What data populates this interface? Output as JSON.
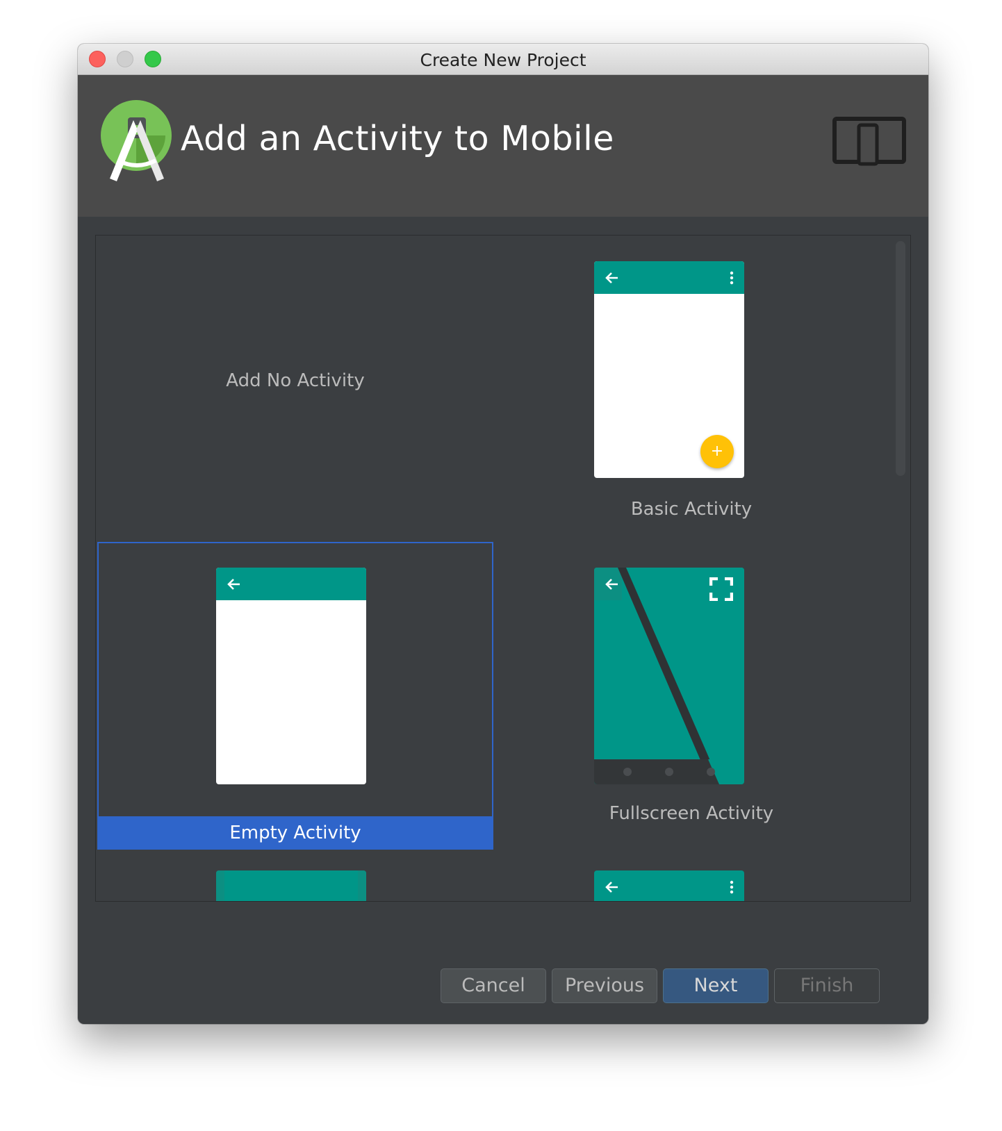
{
  "window": {
    "title": "Create New Project"
  },
  "header": {
    "heading": "Add an Activity to Mobile",
    "logo_icon": "android-studio-logo-icon",
    "device_icon": "phone-tablet-icon"
  },
  "gallery": {
    "tiles": [
      {
        "label": "Add No Activity",
        "selected": false
      },
      {
        "label": "Basic Activity",
        "selected": false
      },
      {
        "label": "Empty Activity",
        "selected": true
      },
      {
        "label": "Fullscreen Activity",
        "selected": false
      }
    ],
    "fab_glyph": "+"
  },
  "buttons": {
    "cancel": "Cancel",
    "previous": "Previous",
    "next": "Next",
    "finish": "Finish"
  },
  "colors": {
    "accent_teal": "#009688",
    "selection_blue": "#2f65ca",
    "fab_yellow": "#ffc107"
  }
}
